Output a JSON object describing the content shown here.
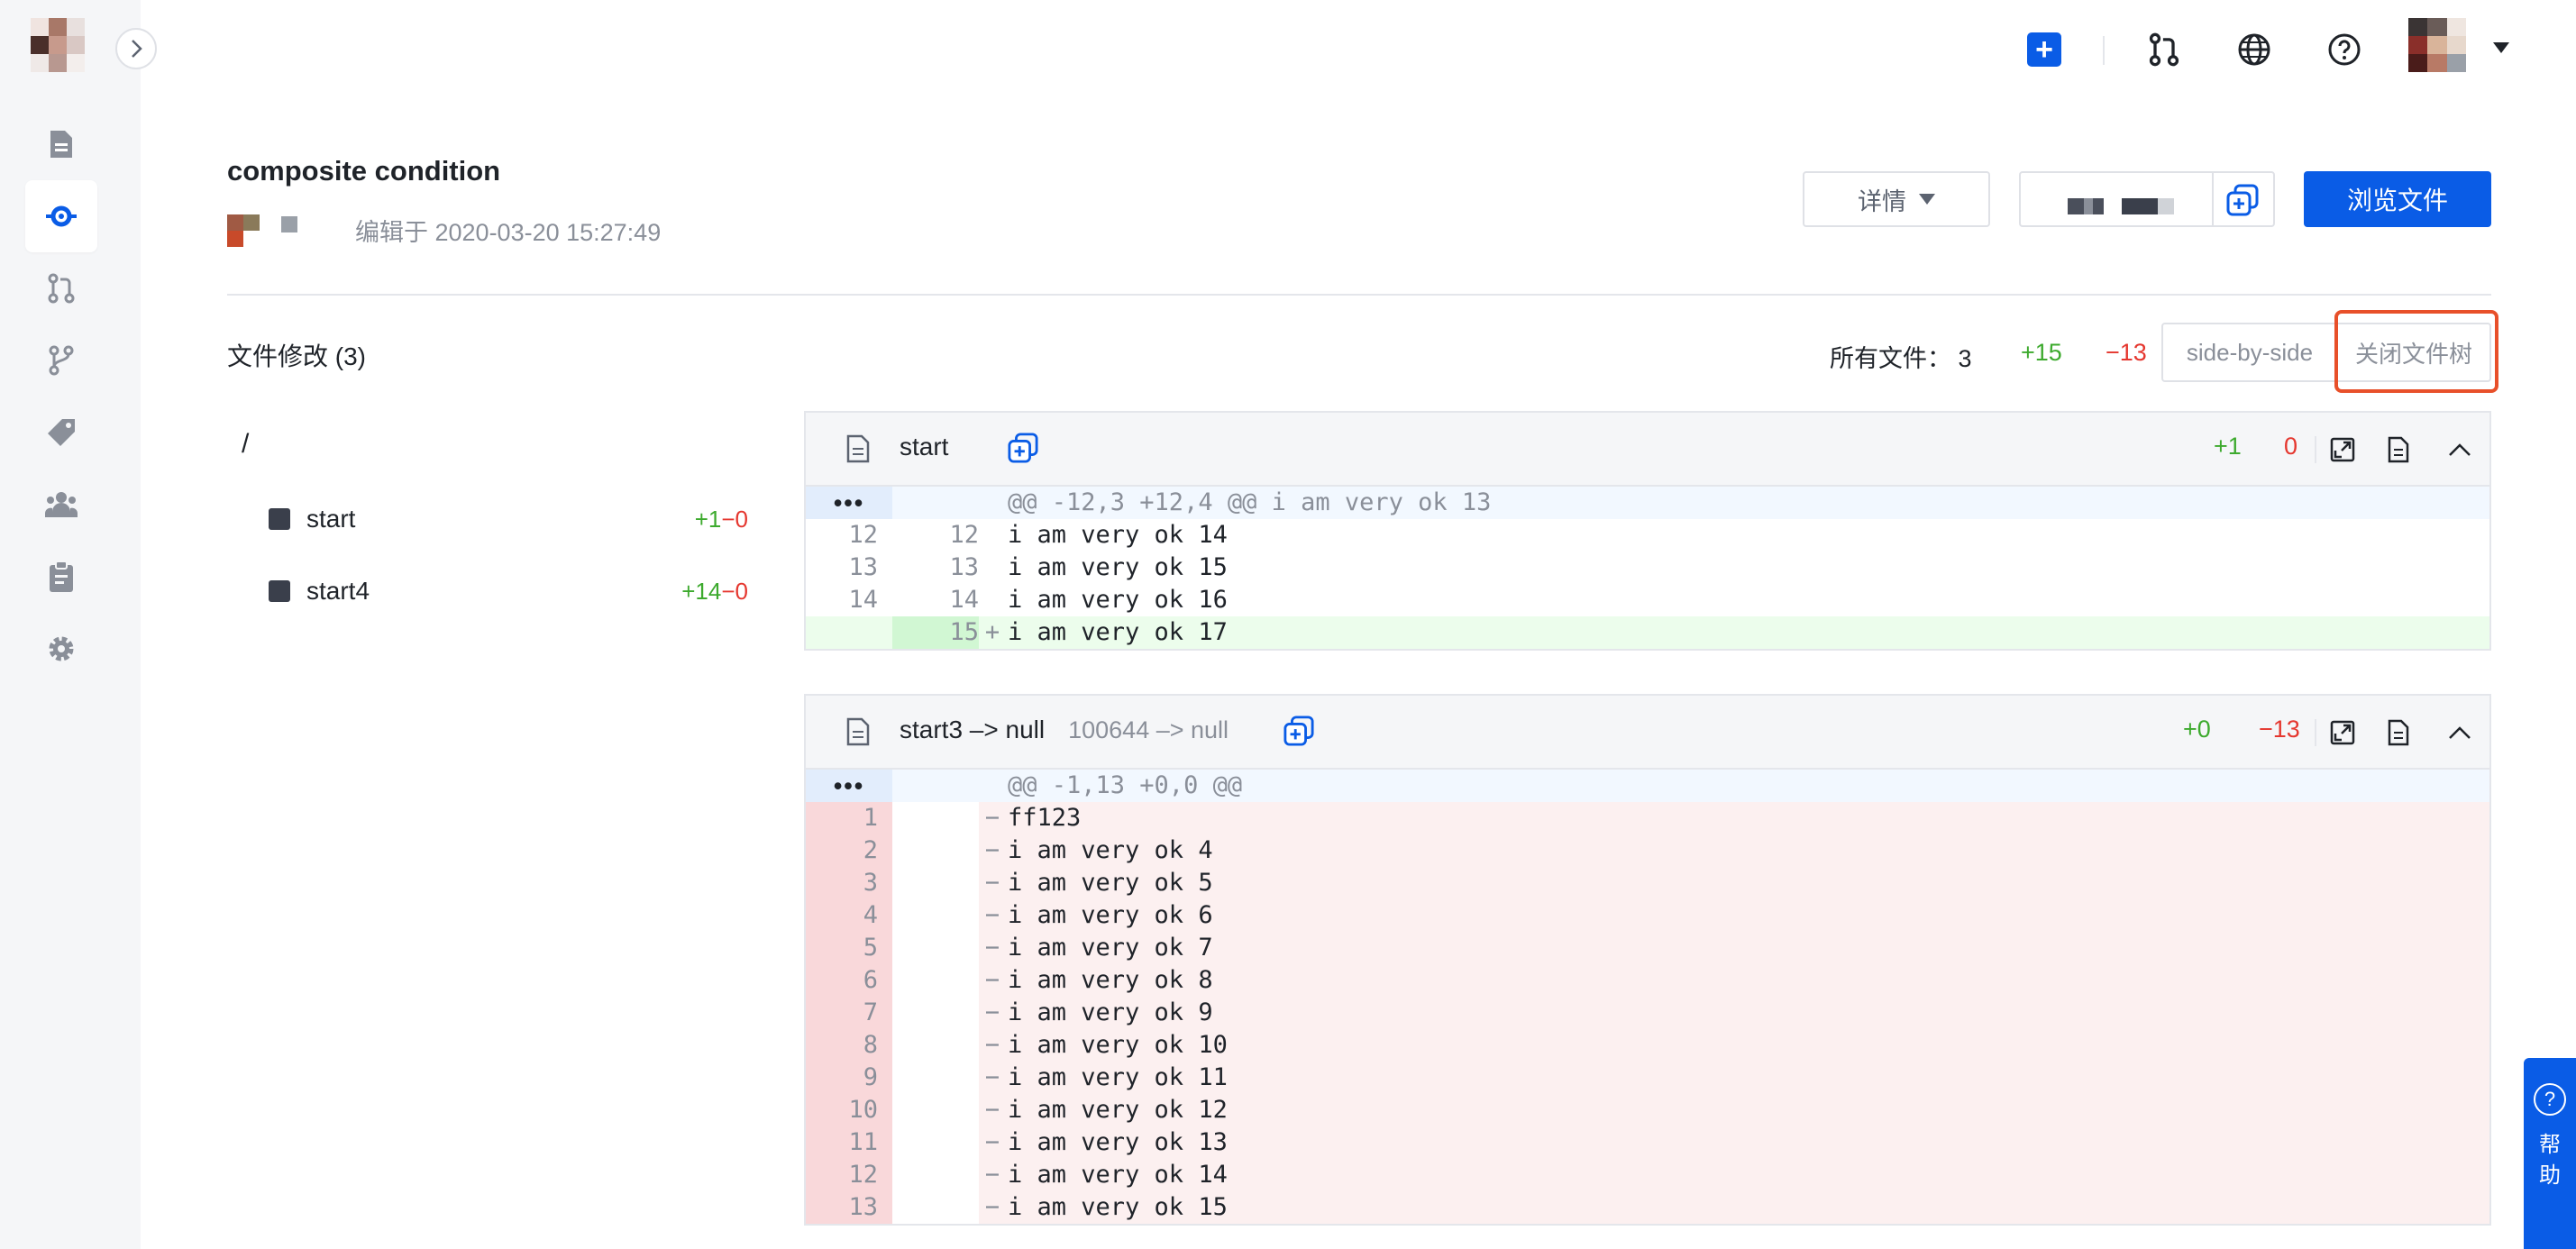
{
  "header": {
    "title": "composite condition",
    "edited_label": "编辑于 2020-03-20 15:27:49",
    "details_button": "详情",
    "browse_button": "浏览文件"
  },
  "changes": {
    "title": "文件修改 (3)",
    "all_files_label": "所有文件： 3",
    "total_additions": "+15",
    "total_deletions": "−13",
    "view_mode": "side-by-side",
    "close_tree_button": "关闭文件树"
  },
  "tree": {
    "root": "/",
    "items": [
      {
        "name": "start",
        "add": "+1",
        "del": "−0"
      },
      {
        "name": "start4",
        "add": "+14",
        "del": "−0"
      }
    ]
  },
  "diffs": [
    {
      "file": "start",
      "mode": "",
      "additions": "+1",
      "deletions": "0",
      "hunk_marker": "•••",
      "hunk_header": "@@ -12,3 +12,4 @@ i am very ok 13",
      "lines": [
        {
          "type": "ctx",
          "old": "12",
          "new": "12",
          "sign": "",
          "text": "i am very ok 14"
        },
        {
          "type": "ctx",
          "old": "13",
          "new": "13",
          "sign": "",
          "text": "i am very ok 15"
        },
        {
          "type": "ctx",
          "old": "14",
          "new": "14",
          "sign": "",
          "text": "i am very ok 16"
        },
        {
          "type": "add",
          "old": "",
          "new": "15",
          "sign": "+",
          "text": "i am very ok 17"
        }
      ]
    },
    {
      "file": "start3 –> null",
      "mode": "100644 –> null",
      "additions": "+0",
      "deletions": "−13",
      "hunk_marker": "•••",
      "hunk_header": "@@ -1,13 +0,0 @@",
      "lines": [
        {
          "type": "del",
          "old": "1",
          "new": "",
          "sign": "−",
          "text": "ff123"
        },
        {
          "type": "del",
          "old": "2",
          "new": "",
          "sign": "−",
          "text": "i am very ok 4"
        },
        {
          "type": "del",
          "old": "3",
          "new": "",
          "sign": "−",
          "text": "i am very ok 5"
        },
        {
          "type": "del",
          "old": "4",
          "new": "",
          "sign": "−",
          "text": "i am very ok 6"
        },
        {
          "type": "del",
          "old": "5",
          "new": "",
          "sign": "−",
          "text": "i am very ok 7"
        },
        {
          "type": "del",
          "old": "6",
          "new": "",
          "sign": "−",
          "text": "i am very ok 8"
        },
        {
          "type": "del",
          "old": "7",
          "new": "",
          "sign": "−",
          "text": "i am very ok 9"
        },
        {
          "type": "del",
          "old": "8",
          "new": "",
          "sign": "−",
          "text": "i am very ok 10"
        },
        {
          "type": "del",
          "old": "9",
          "new": "",
          "sign": "−",
          "text": "i am very ok 11"
        },
        {
          "type": "del",
          "old": "10",
          "new": "",
          "sign": "−",
          "text": "i am very ok 12"
        },
        {
          "type": "del",
          "old": "11",
          "new": "",
          "sign": "−",
          "text": "i am very ok 13"
        },
        {
          "type": "del",
          "old": "12",
          "new": "",
          "sign": "−",
          "text": "i am very ok 14"
        },
        {
          "type": "del",
          "old": "13",
          "new": "",
          "sign": "−",
          "text": "i am very ok 15"
        }
      ]
    }
  ],
  "help": {
    "label": "帮助"
  },
  "colors": {
    "primary": "#0a5ce6",
    "addition": "#3daa2e",
    "deletion": "#e5372f",
    "highlight": "#e8502a"
  }
}
